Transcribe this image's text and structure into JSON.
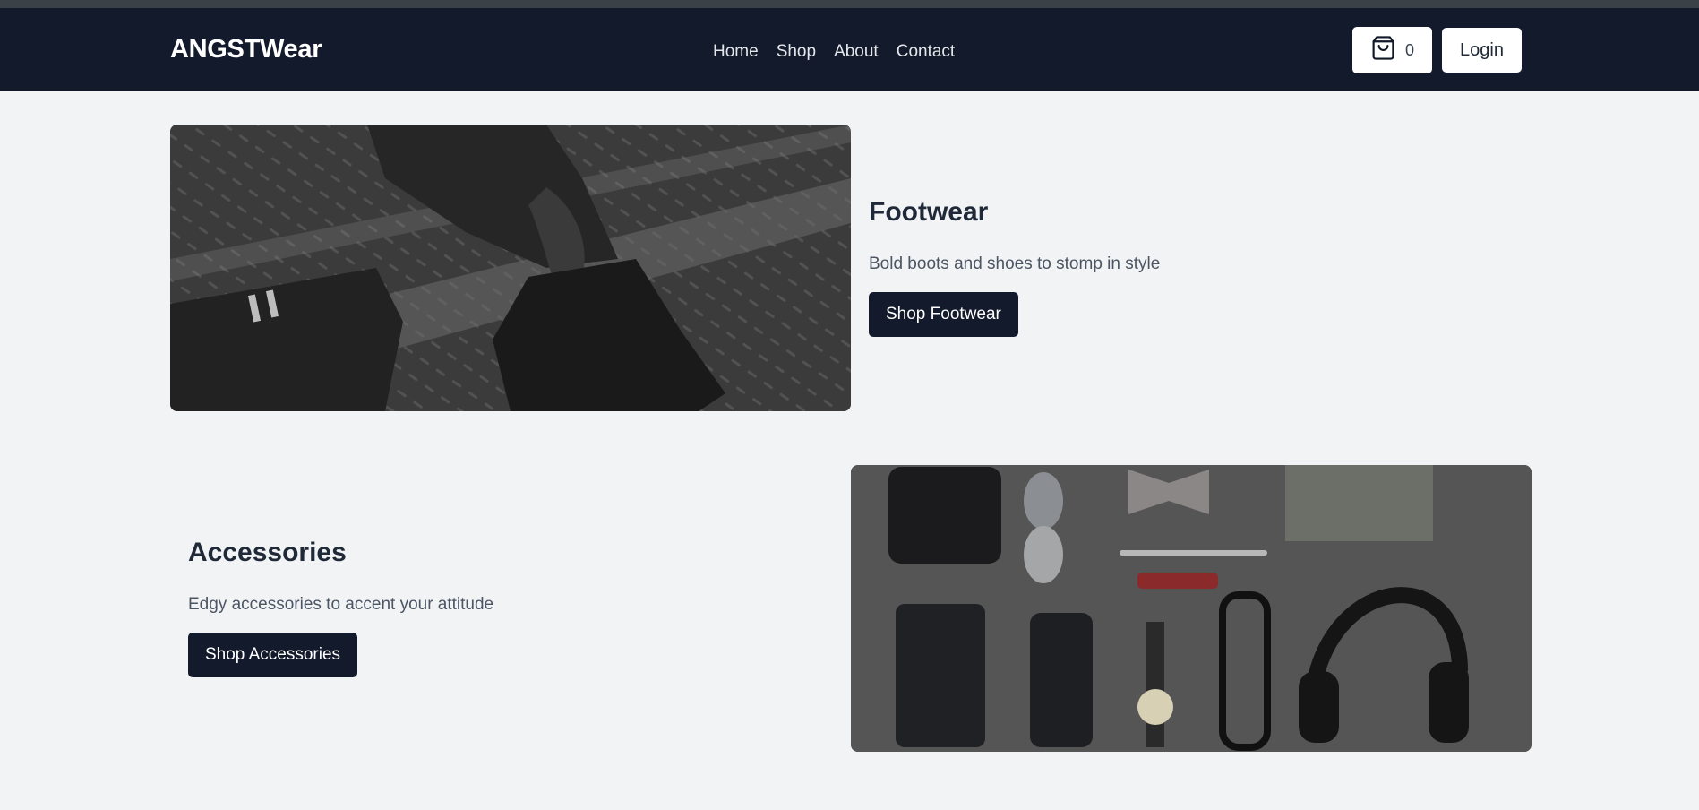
{
  "brand": "ANGSTWear",
  "nav": {
    "links": [
      "Home",
      "Shop",
      "About",
      "Contact"
    ]
  },
  "cart": {
    "icon": "shopping-bag-icon",
    "count": "0"
  },
  "login_label": "Login",
  "sections": [
    {
      "title": "Footwear",
      "description": "Bold boots and shoes to stomp in style",
      "button_label": "Shop Footwear"
    },
    {
      "title": "Accessories",
      "description": "Edgy accessories to accent your attitude",
      "button_label": "Shop Accessories"
    }
  ],
  "colors": {
    "navbar": "#121a2b",
    "page_bg": "#f2f3f5",
    "button_dark": "#121a2b"
  }
}
